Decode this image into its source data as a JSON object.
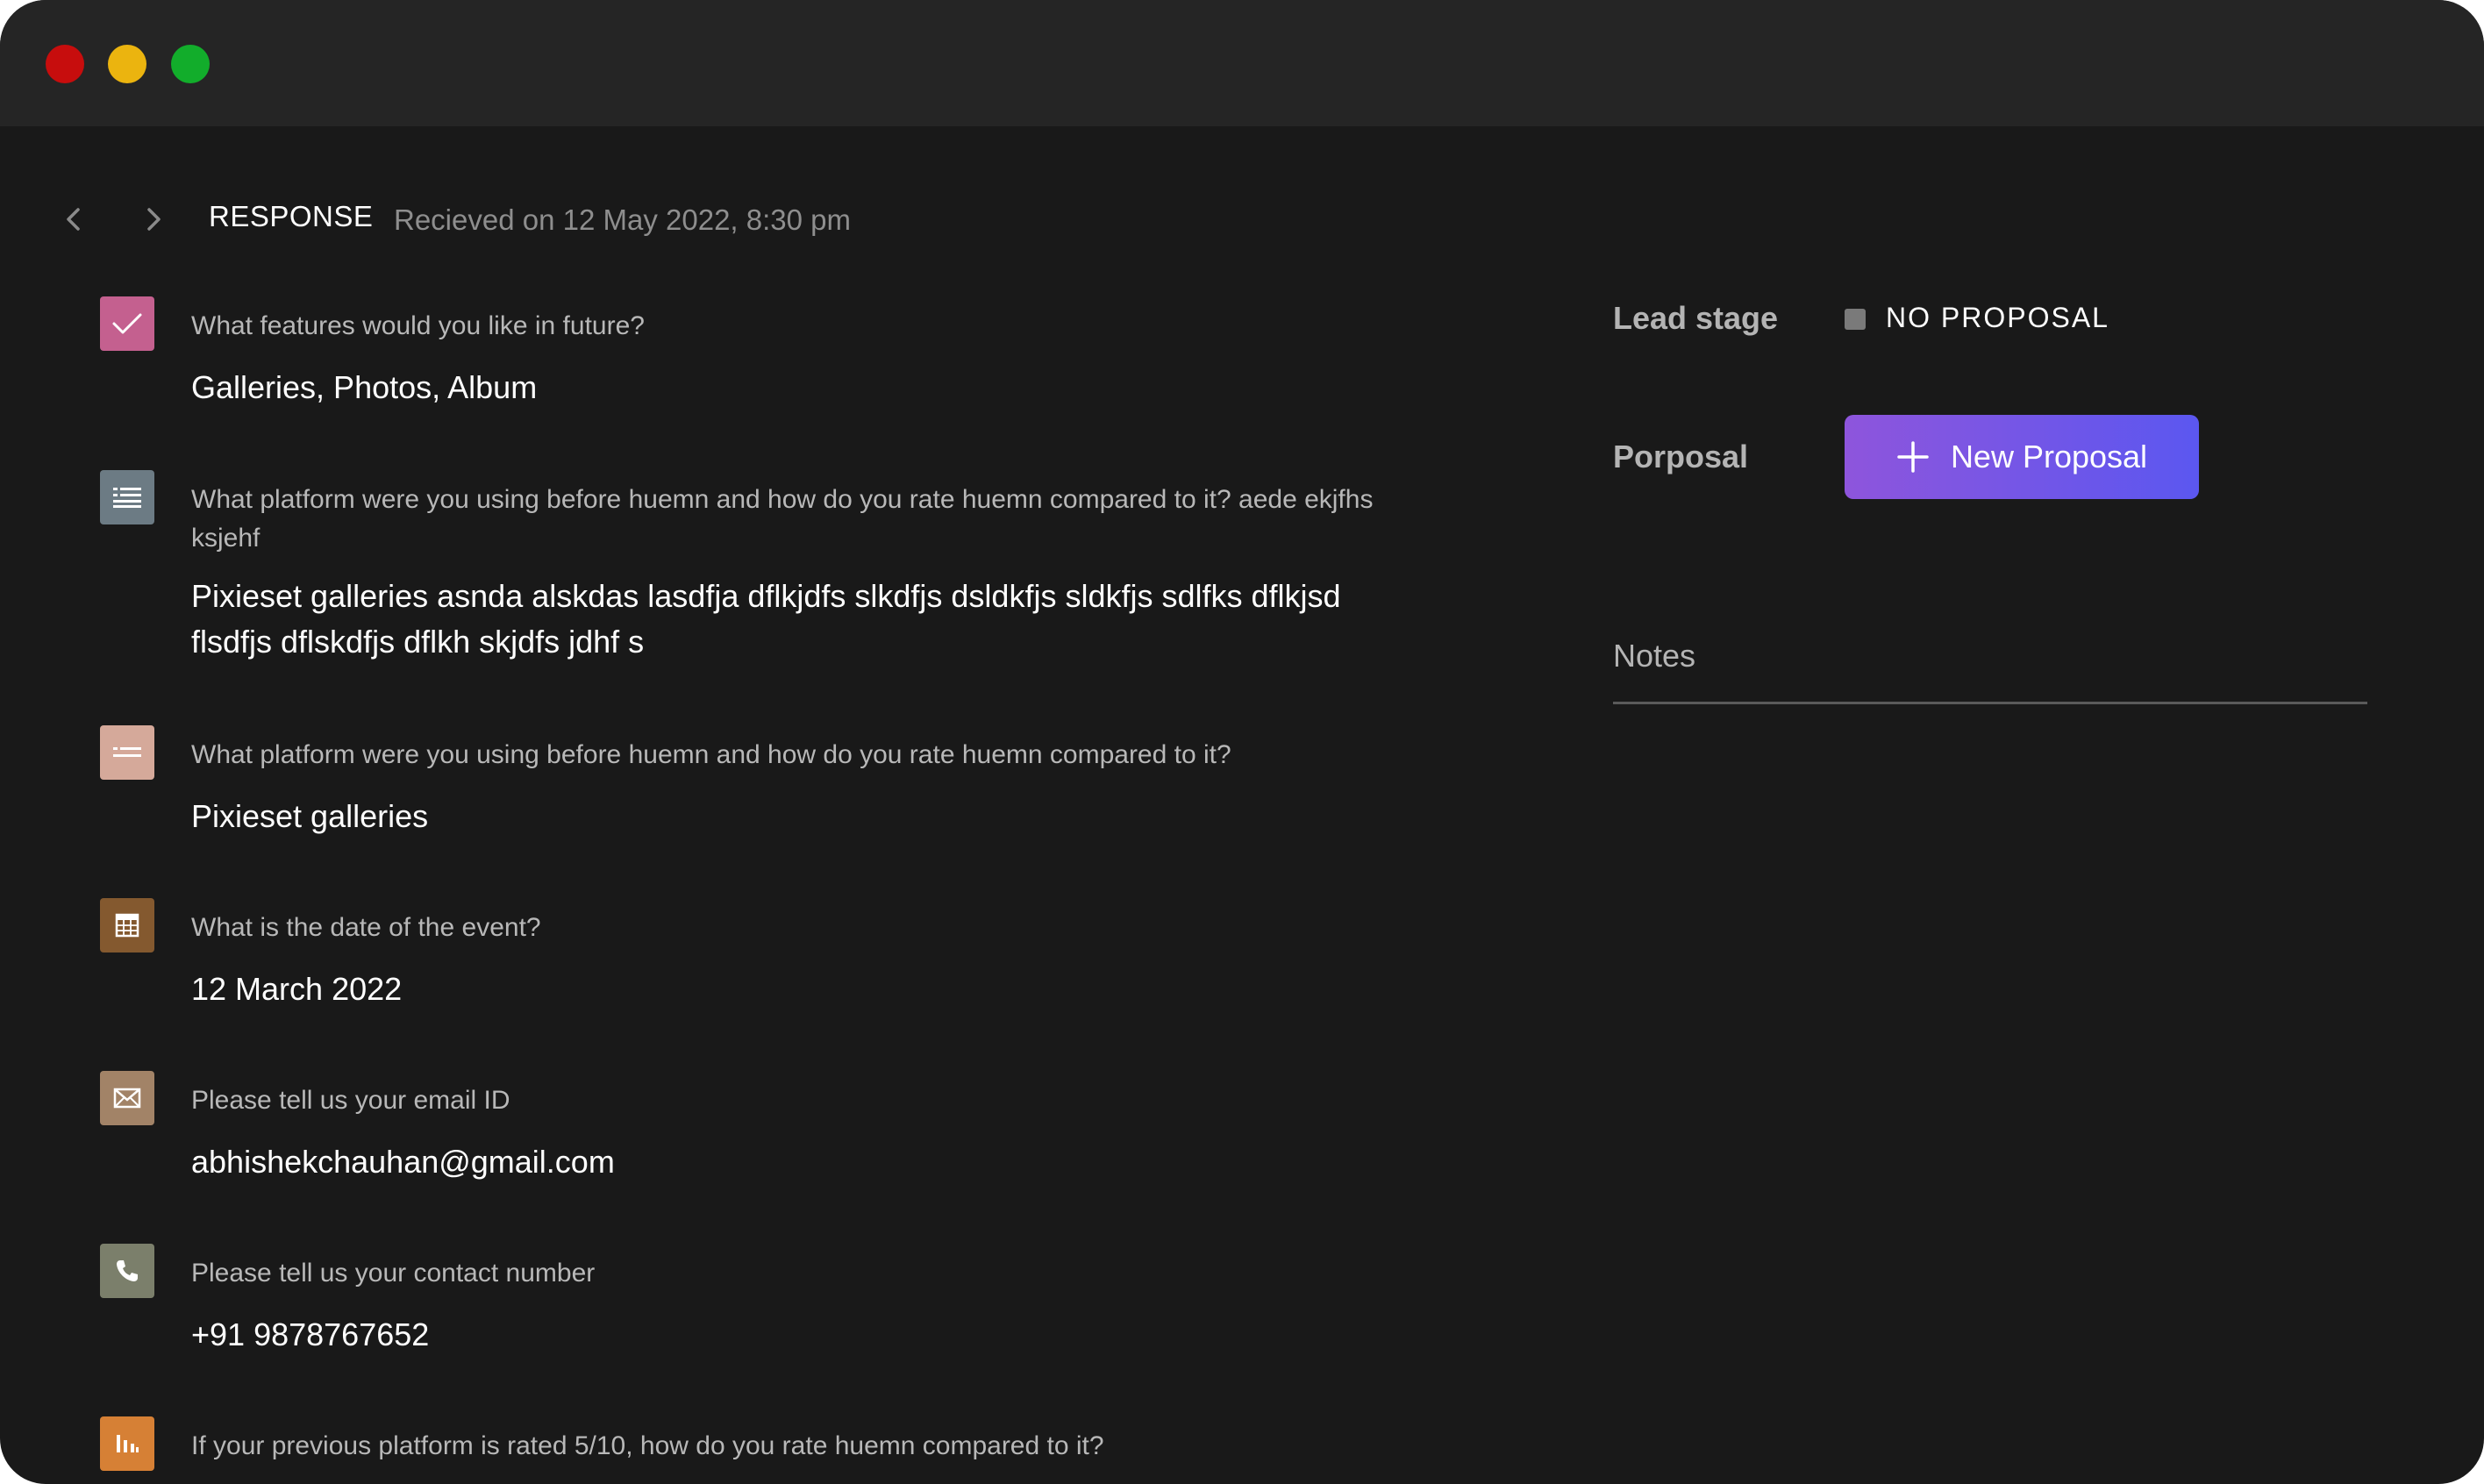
{
  "window": {
    "controls": [
      "close",
      "minimize",
      "maximize"
    ]
  },
  "header": {
    "title": "RESPONSE",
    "received": "Recieved on 12 May 2022, 8:30 pm"
  },
  "responses": [
    {
      "icon": "checkbox-icon",
      "icon_color": "#c4608f",
      "question": "What features would you like in future?",
      "answer": "Galleries, Photos, Album"
    },
    {
      "icon": "long-text-icon",
      "icon_color": "#6c7b84",
      "question": "What platform were you using before huemn and how do you rate huemn compared to it? aede ekjfhs ksjehf",
      "answer": "Pixieset galleries asnda alskdas lasdfja dflkjdfs slkdfjs dsldkfjs sldkfjs sdlfks dflkjsd flsdfjs dflskdfjs dflkh skjdfs jdhf s"
    },
    {
      "icon": "short-text-icon",
      "icon_color": "#d5a99a",
      "question": "What platform were you using before huemn and how do you rate huemn compared to it?",
      "answer": "Pixieset galleries"
    },
    {
      "icon": "calendar-icon",
      "icon_color": "#84592f",
      "question": "What is the date of the event?",
      "answer": "12  March 2022"
    },
    {
      "icon": "email-icon",
      "icon_color": "#a28367",
      "question": "Please tell us your email ID",
      "answer": "abhishekchauhan@gmail.com"
    },
    {
      "icon": "phone-icon",
      "icon_color": "#7b7f6b",
      "question": "Please tell us your contact number",
      "answer": "+91 9878767652"
    },
    {
      "icon": "rating-icon",
      "icon_color": "#d68035",
      "question": "If your previous platform is rated 5/10, how do you rate huemn compared to it?",
      "answer": ""
    }
  ],
  "sidebar": {
    "lead_stage_label": "Lead stage",
    "lead_stage_value": "NO PROPOSAL",
    "proposal_label": "Porposal",
    "new_proposal_button": "New Proposal",
    "notes_label": "Notes"
  }
}
